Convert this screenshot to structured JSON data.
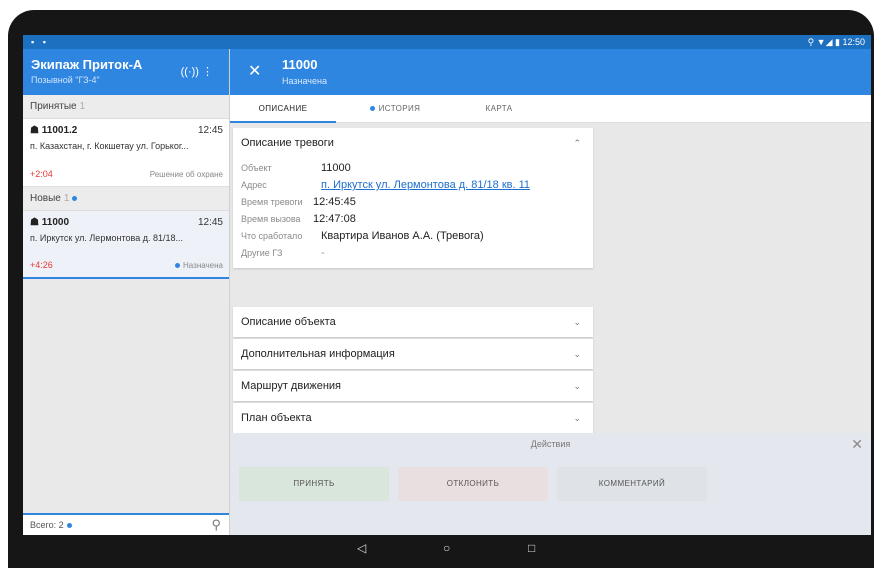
{
  "statusbar": {
    "left_icons": "▪ ▪",
    "right_icons": "⚲ ▼◢ ▮",
    "time": "12:50"
  },
  "left": {
    "title": "Экипаж Приток-А",
    "subtitle": "Позывной \"ГЗ-4\"",
    "header_icons": "((·))   ⋮",
    "sections": {
      "accepted": {
        "label": "Принятые",
        "count": "1"
      },
      "new": {
        "label": "Новые",
        "count": "1"
      }
    },
    "cards": [
      {
        "num": "11001.2",
        "time": "12:45",
        "address": "п. Казахстан, г. Кокшетау ул. Горьког...",
        "delta": "+2:04",
        "state": "Решение об охране"
      },
      {
        "num": "11000",
        "time": "12:45",
        "address": "п. Иркутск ул. Лермонтова д. 81/18...",
        "delta": "+4:26",
        "state": "Назначена"
      }
    ],
    "footer": "Всего: 2"
  },
  "right": {
    "title": "11000",
    "subtitle": "Назначена",
    "tabs": {
      "description": "ОПИСАНИЕ",
      "history": "ИСТОРИЯ",
      "map": "КАРТА"
    },
    "alarm_panel": {
      "title": "Описание тревоги",
      "rows": [
        {
          "label": "Объект",
          "value": "11000"
        },
        {
          "label": "Адрес",
          "value": "п. Иркутск ул. Лермонтова д. 81/18 кв. 11"
        },
        {
          "label": "Время тревоги",
          "value": "12:45:45"
        },
        {
          "label": "Время вызова",
          "value": "12:47:08"
        },
        {
          "label": "Что сработало",
          "value": "Квартира Иванов А.А. (Тревога)"
        },
        {
          "label": "Другие ГЗ",
          "value": "-"
        }
      ]
    },
    "collapsed_panels": [
      "Описание объекта",
      "Дополнительная информация",
      "Маршрут движения",
      "План объекта"
    ],
    "actions": {
      "title": "Действия",
      "accept": "ПРИНЯТЬ",
      "decline": "ОТКЛОНИТЬ",
      "comment": "КОММЕНТАРИЙ"
    }
  },
  "colors": {
    "accent": "#2f86e0",
    "delta": "#e53935",
    "accept_bg": "#d9e6dc",
    "decline_bg": "#eadfe0",
    "comment_bg": "#dfe3e8"
  }
}
